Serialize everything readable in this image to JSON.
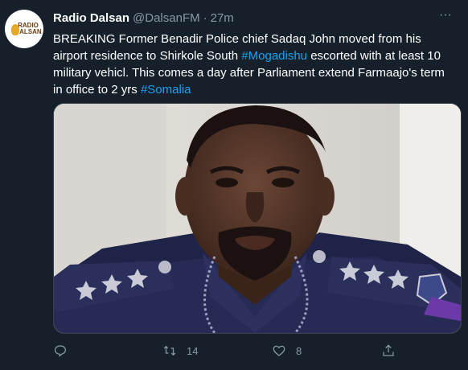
{
  "tweet": {
    "author_name": "Radio Dalsan",
    "handle": "@DalsanFM",
    "separator": "·",
    "time": "27m",
    "more_label": "···",
    "avatar_text": [
      "RADIO",
      "DALSAN"
    ],
    "text_parts": [
      "BREAKING Former Benadir Police chief Sadaq John moved from his  airport residence to Shirkole South ",
      "#Mogadishu",
      " escorted with at least 10 military vehicl. This comes a day after Parliament extend Farmaajo's term in office to 2 yrs ",
      "#Somalia"
    ],
    "retweet_count": "14",
    "like_count": "8"
  },
  "colors": {
    "background": "#15202b",
    "text": "#ffffff",
    "secondary": "#8899a6",
    "link": "#1da1f2",
    "border": "#38444d"
  },
  "icons": {
    "reply": "comment-bubble-icon",
    "retweet": "retweet-icon",
    "like": "heart-icon",
    "share": "share-upload-icon",
    "more": "more-dots-icon"
  }
}
